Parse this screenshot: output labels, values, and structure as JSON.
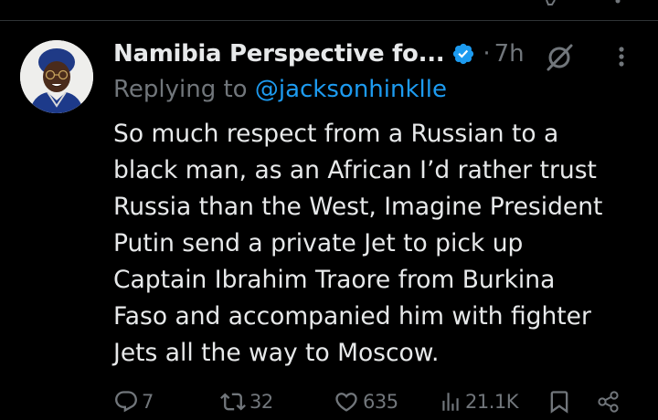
{
  "tweet": {
    "author_name": "Namibia Perspective fo...",
    "verified": true,
    "separator": "·",
    "timestamp": "7h",
    "replying_prefix": "Replying to ",
    "replying_handle": "@jacksonhinklle",
    "text": "So much respect from a Russian to a\nblack man, as an African I’d rather trust\nRussia than the West, Imagine President\nPutin send a private Jet to pick up\nCaptain Ibrahim Traore from Burkina\nFaso and accompanied him with fighter\nJets all the way to Moscow.",
    "actions": {
      "replies": "7",
      "reposts": "32",
      "likes": "635",
      "views": "21.1K"
    }
  },
  "icons": {
    "top": [
      "partial-icon"
    ],
    "header": [
      "verified-badge-icon",
      "grok-icon",
      "more-options-icon"
    ],
    "actions": [
      "reply-icon",
      "repost-icon",
      "like-icon",
      "views-icon",
      "bookmark-icon",
      "share-icon"
    ]
  },
  "colors": {
    "background": "#000000",
    "text_primary": "#e7e9ea",
    "text_secondary": "#71767b",
    "accent": "#1d9bf0",
    "divider": "#2f3336"
  }
}
